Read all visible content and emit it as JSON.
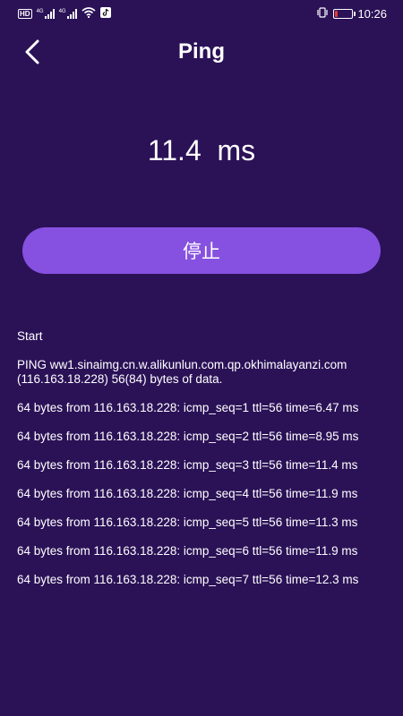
{
  "status_bar": {
    "hd_badge": "HD",
    "network_labels": [
      "4G",
      "4G"
    ],
    "time": "10:26",
    "battery_level": 0.2,
    "battery_color": "#e53935",
    "icons": [
      "hd-icon",
      "signal-icon",
      "wifi-icon",
      "tiktok-icon",
      "vibrate-icon",
      "battery-icon"
    ]
  },
  "header": {
    "title": "Ping",
    "back_icon": "chevron-left-icon"
  },
  "readout": {
    "value": "11.4",
    "unit": "ms",
    "display": "11.4  ms"
  },
  "stop_button": {
    "label": "停止",
    "color": "#8650e0"
  },
  "log": {
    "lines": [
      "Start",
      "PING ww1.sinaimg.cn.w.alikunlun.com.qp.okhimalayanzi.com (116.163.18.228) 56(84) bytes of data.",
      "64 bytes from 116.163.18.228: icmp_seq=1 ttl=56 time=6.47 ms",
      "64 bytes from 116.163.18.228: icmp_seq=2 ttl=56 time=8.95 ms",
      "64 bytes from 116.163.18.228: icmp_seq=3 ttl=56 time=11.4 ms",
      "64 bytes from 116.163.18.228: icmp_seq=4 ttl=56 time=11.9 ms",
      "64 bytes from 116.163.18.228: icmp_seq=5 ttl=56 time=11.3 ms",
      "64 bytes from 116.163.18.228: icmp_seq=6 ttl=56 time=11.9 ms",
      "64 bytes from 116.163.18.228: icmp_seq=7 ttl=56 time=12.3 ms"
    ]
  },
  "colors": {
    "background": "#2b1257",
    "text": "#ffffff"
  }
}
